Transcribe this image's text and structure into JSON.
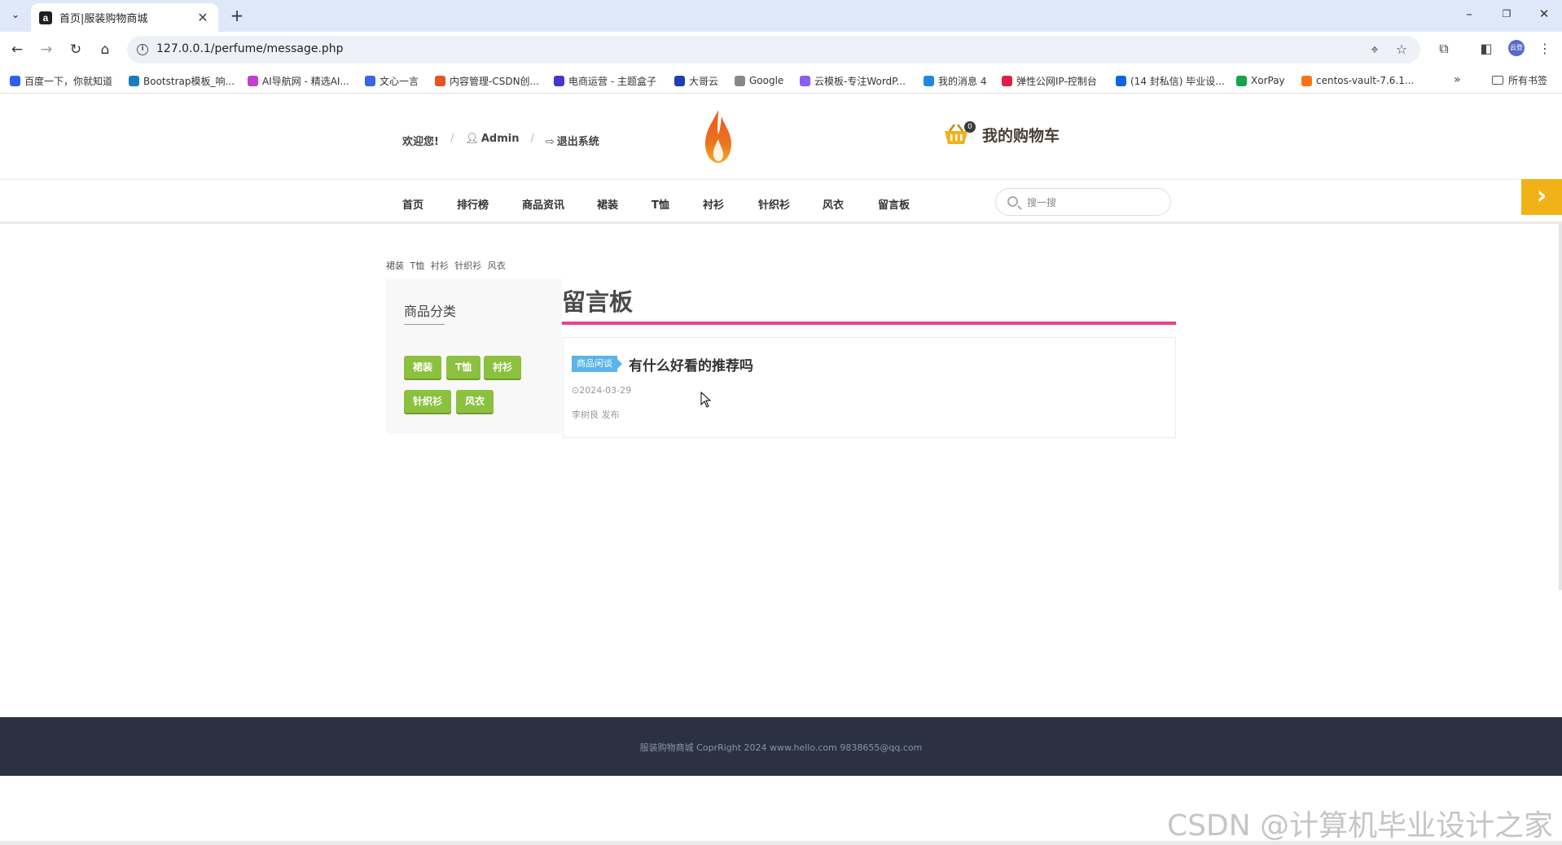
{
  "browser": {
    "tab_title": "首页|服装购物商城",
    "favicon_letter": "a",
    "url": "127.0.0.1/perfume/message.php",
    "profile_label": "云登",
    "bookmarks": [
      {
        "label": "百度一下，你就知道",
        "color": "#2e5ff0"
      },
      {
        "label": "Bootstrap模板_响...",
        "color": "#1a7bc0"
      },
      {
        "label": "AI导航网 - 精选AI...",
        "color": "#c03fd0"
      },
      {
        "label": "文心一言",
        "color": "#3a64e8"
      },
      {
        "label": "内容管理-CSDN创...",
        "color": "#e8531f"
      },
      {
        "label": "电商运营 - 主题盒子",
        "color": "#4338ca"
      },
      {
        "label": "大哥云",
        "color": "#1e40af"
      },
      {
        "label": "Google",
        "color": "#888888"
      },
      {
        "label": "云模板-专注WordP...",
        "color": "#8b5cf6"
      },
      {
        "label": "我的消息 4",
        "color": "#1e88e5"
      },
      {
        "label": "弹性公网IP-控制台",
        "color": "#e11d48"
      },
      {
        "label": "(14 封私信) 毕业设...",
        "color": "#0b66e4"
      },
      {
        "label": "XorPay",
        "color": "#16a34a"
      },
      {
        "label": "centos-vault-7.6.1...",
        "color": "#f97316"
      }
    ],
    "all_bookmarks_label": "所有书签"
  },
  "header": {
    "welcome": "欢迎您!",
    "user": "Admin",
    "logout": "退出系统",
    "cart_label": "我的购物车",
    "cart_count": "0"
  },
  "nav": {
    "items": [
      "首页",
      "排行榜",
      "商品资讯",
      "裙装",
      "T恤",
      "衬衫",
      "针织衫",
      "风衣",
      "留言板"
    ],
    "search_placeholder": "搜一搜"
  },
  "breadcrumb_categories": [
    "裙装",
    "T恤",
    "衬衫",
    "针织衫",
    "风衣"
  ],
  "sidebar": {
    "title": "商品分类",
    "tags": [
      "裙装",
      "T恤",
      "衬衫",
      "针织衫",
      "风衣"
    ]
  },
  "board": {
    "title": "留言板",
    "posts": [
      {
        "badge": "商品闲谈",
        "title": "有什么好看的推荐吗",
        "date": "2024-03-29",
        "author": "李树良 发布"
      }
    ]
  },
  "footer": {
    "text": "服装购物商城 CoprRight 2024 www.hello.com 9838655@qq.com"
  },
  "watermark": "CSDN @计算机毕业设计之家"
}
